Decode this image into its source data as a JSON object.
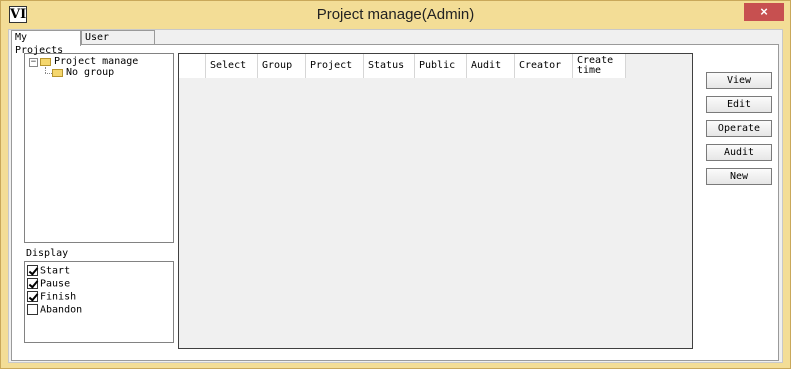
{
  "window": {
    "title": "Project manage(Admin)",
    "icon_glyph": "VI",
    "close_glyph": "×"
  },
  "tabs": [
    {
      "label": "My Projects",
      "active": true
    },
    {
      "label": "User Projects",
      "active": false
    }
  ],
  "tree": {
    "root": {
      "label": "Project manage",
      "expander": "−"
    },
    "children": [
      {
        "label": "No group"
      }
    ]
  },
  "display": {
    "label": "Display",
    "options": [
      {
        "label": "Start",
        "checked": true
      },
      {
        "label": "Pause",
        "checked": true
      },
      {
        "label": "Finish",
        "checked": true
      },
      {
        "label": "Abandon",
        "checked": false
      }
    ]
  },
  "grid": {
    "columns": [
      "Select",
      "Group",
      "Project",
      "Status",
      "Public",
      "Audit",
      "Creator",
      "Create\ntime"
    ],
    "rows": []
  },
  "actions": {
    "view": "View",
    "edit": "Edit",
    "operate": "Operate",
    "audit": "Audit",
    "new": "New"
  },
  "colors": {
    "frame": "#f3dd96",
    "close": "#c75050"
  }
}
